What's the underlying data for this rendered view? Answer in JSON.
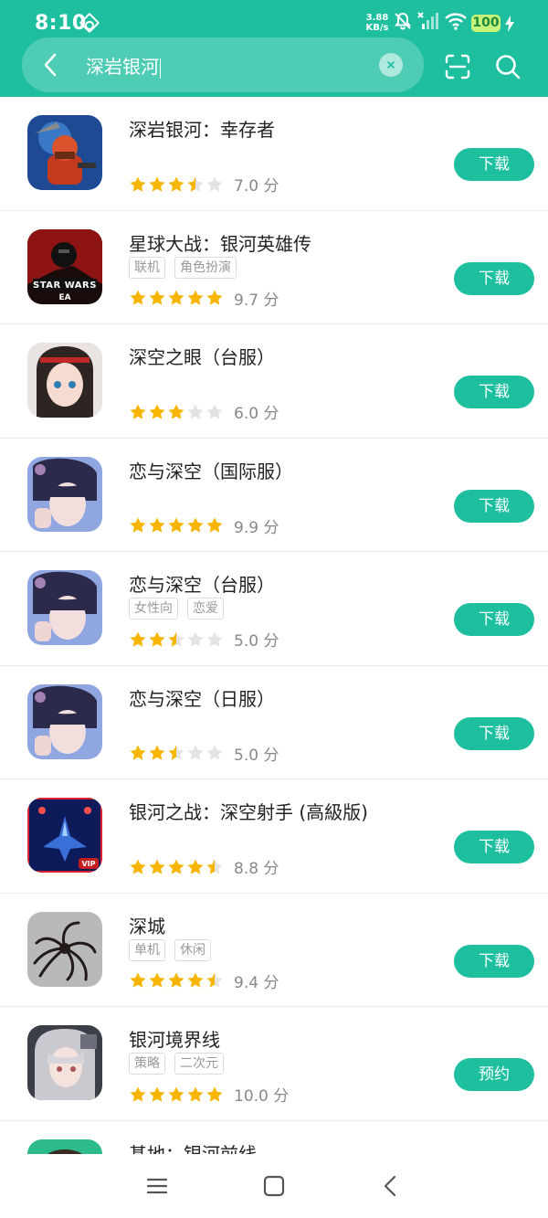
{
  "status_bar": {
    "time": "8:10",
    "net_speed": "3.88",
    "net_unit": "KB/s",
    "battery": "100"
  },
  "search": {
    "query": "深岩银河"
  },
  "colors": {
    "accent": "#1ebf9f",
    "star": "#f7b500",
    "star_empty": "#e3e3e3"
  },
  "apps": [
    {
      "name": "深岩银河：幸存者",
      "tags": [],
      "rating": 3.5,
      "score": "7.0 分",
      "action": "下载"
    },
    {
      "name": "星球大战：银河英雄传",
      "tags": [
        "联机",
        "角色扮演"
      ],
      "rating": 5,
      "score": "9.7 分",
      "action": "下载"
    },
    {
      "name": "深空之眼（台服）",
      "tags": [],
      "rating": 3,
      "score": "6.0 分",
      "action": "下载"
    },
    {
      "name": "恋与深空（国际服）",
      "tags": [],
      "rating": 5,
      "score": "9.9 分",
      "action": "下载"
    },
    {
      "name": "恋与深空（台服）",
      "tags": [
        "女性向",
        "恋爱"
      ],
      "rating": 2.5,
      "score": "5.0 分",
      "action": "下载"
    },
    {
      "name": "恋与深空（日服）",
      "tags": [],
      "rating": 2.5,
      "score": "5.0 分",
      "action": "下载"
    },
    {
      "name": "银河之战：深空射手 (高級版)",
      "tags": [],
      "rating": 4.5,
      "score": "8.8 分",
      "action": "下载"
    },
    {
      "name": "深城",
      "tags": [
        "单机",
        "休闲"
      ],
      "rating": 4.5,
      "score": "9.4 分",
      "action": "下载"
    },
    {
      "name": "银河境界线",
      "tags": [
        "策略",
        "二次元"
      ],
      "rating": 5,
      "score": "10.0 分",
      "action": "预约"
    },
    {
      "name": "基地：银河前线",
      "tags": [],
      "rating": 0,
      "score": "",
      "action": ""
    }
  ]
}
